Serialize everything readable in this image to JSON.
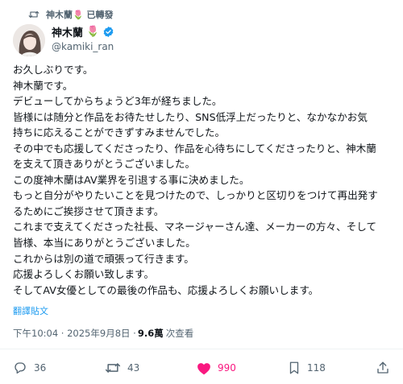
{
  "repost": {
    "name": "神木蘭",
    "flower": "🌷",
    "suffix": "已轉發"
  },
  "author": {
    "name": "神木蘭",
    "flower": "🌷",
    "handle": "@kamiki_ran",
    "verified_color": "#1d9bf0"
  },
  "tweet_lines": [
    "お久しぶりです。",
    "神木蘭です。",
    "デビューしてからちょうど3年が経ちました。",
    "皆様には随分と作品をお待たせしたり、SNS低浮上だったりと、なかなかお気",
    "持ちに応えることができずすみませんでした。",
    "その中でも応援してくださったり、作品を心待ちにしてくださったりと、神木蘭",
    "を支えて頂きありがとうございました。",
    "この度神木蘭はAV業界を引退する事に決めました。",
    "もっと自分がやりたいことを見つけたので、しっかりと区切りをつけて再出発す",
    "るためにご挨拶させて頂きます。",
    "これまで支えてくださった社長、マネージャーさん達、メーカーの方々、そして",
    "皆様、本当にありがとうございました。",
    "これからは別の道で頑張って行きます。",
    "応援よろしくお願い致します。",
    "そしてAV女優としての最後の作品も、応援よろしくお願いします。"
  ],
  "translate_label": "翻譯貼文",
  "meta": {
    "time": "下午10:04 · 2025年9月8日 · ",
    "views": "9.6萬",
    "views_label": "次查看"
  },
  "actions": {
    "reply": {
      "icon": "reply-icon",
      "count": "36"
    },
    "retweet": {
      "icon": "retweet-icon",
      "count": "43"
    },
    "like": {
      "icon": "heart-icon",
      "count": "990",
      "color": "#f91880"
    },
    "bookmark": {
      "icon": "bookmark-icon",
      "count": "118"
    },
    "share": {
      "icon": "share-icon"
    }
  }
}
